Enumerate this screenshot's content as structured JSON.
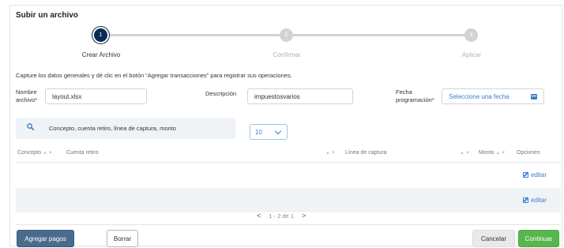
{
  "page": {
    "title": "Subir un archivo"
  },
  "stepper": {
    "steps": [
      {
        "number": "1",
        "label": "Crear Archivo",
        "state": "active"
      },
      {
        "number": "2",
        "label": "Confirmar",
        "state": "inactive"
      },
      {
        "number": "3",
        "label": "Aplicar",
        "state": "inactive"
      }
    ]
  },
  "instructions": "Capture los datos generales y dé clic en el botón “Agregar transacciones” para registrar sus operaciones.",
  "form": {
    "nombre_label_1": "Nombre",
    "nombre_label_2": "archivo*",
    "nombre_value": "layout.xlsx",
    "descripcion_label": "Descripción",
    "descripcion_value": "impuestosvarios",
    "fecha_label_1": "Fecha",
    "fecha_label_2": "programación*",
    "fecha_placeholder": "Seleccione una fecha",
    "calendar_icon": "calendar-icon"
  },
  "search": {
    "icon": "search-icon",
    "placeholder": "Concepto, cuenta retiro, línea de captura, monto"
  },
  "page_size": {
    "selected": "10"
  },
  "table": {
    "headers": {
      "concepto": "Concepto",
      "cuenta_retiro": "Cuenta retiro",
      "linea_captura": "Línea de captura",
      "monto": "Monto",
      "opciones": "Opciones"
    },
    "sort_glyph": "▲▼",
    "rows": [
      {
        "action": "editar",
        "action_icon": "edit-icon"
      },
      {
        "action": "editar",
        "action_icon": "edit-icon"
      }
    ]
  },
  "pagination": {
    "prev": "<",
    "range": "1 - 2",
    "of": "de 1",
    "next": ">"
  },
  "footer": {
    "add_button": "Agregar pagos",
    "delete_button": "Borrar",
    "cancel_button": "Cancelar",
    "continue_button": "Continuar"
  },
  "colors": {
    "active_step": "#0d2b52",
    "link_blue": "#3d7ed1",
    "primary_button": "#4a6c8c",
    "continue_green": "#59b64f"
  }
}
